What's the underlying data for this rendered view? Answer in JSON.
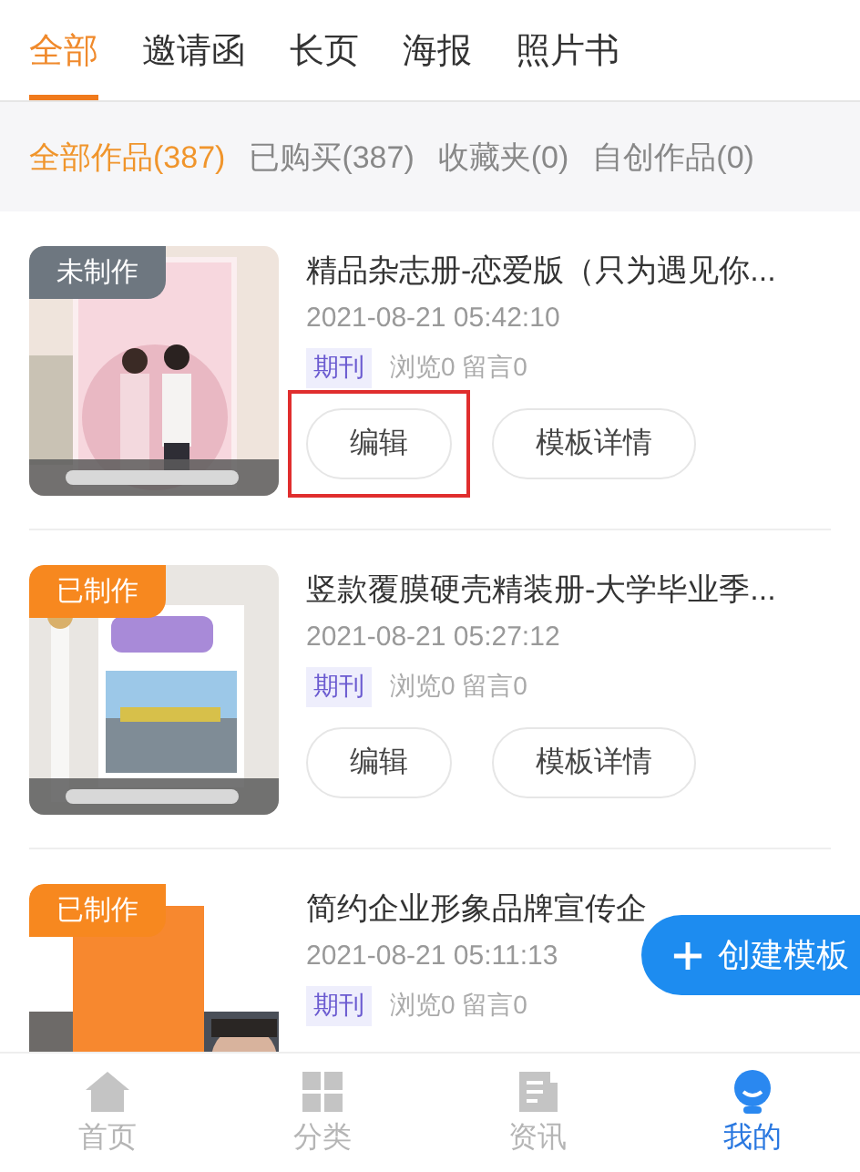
{
  "tabs": [
    {
      "label": "全部",
      "selected": true
    },
    {
      "label": "邀请函",
      "selected": false
    },
    {
      "label": "长页",
      "selected": false
    },
    {
      "label": "海报",
      "selected": false
    },
    {
      "label": "照片书",
      "selected": false
    }
  ],
  "filters": [
    {
      "label": "全部作品(387)",
      "selected": true
    },
    {
      "label": "已购买(387)",
      "selected": false
    },
    {
      "label": "收藏夹(0)",
      "selected": false
    },
    {
      "label": "自创作品(0)",
      "selected": false
    }
  ],
  "works": [
    {
      "status": {
        "label": "未制作",
        "done": false
      },
      "title": "精品杂志册-恋爱版（只为遇见你...",
      "date": "2021-08-21 05:42:10",
      "tag": "期刊",
      "stats": "浏览0 留言0",
      "buttons": [
        {
          "label": "编辑",
          "highlighted": true
        },
        {
          "label": "模板详情",
          "highlighted": false
        }
      ]
    },
    {
      "status": {
        "label": "已制作",
        "done": true
      },
      "title": "竖款覆膜硬壳精装册-大学毕业季...",
      "date": "2021-08-21 05:27:12",
      "tag": "期刊",
      "stats": "浏览0 留言0",
      "buttons": [
        {
          "label": "编辑",
          "highlighted": false
        },
        {
          "label": "模板详情",
          "highlighted": false
        }
      ]
    },
    {
      "status": {
        "label": "已制作",
        "done": true
      },
      "title": "简约企业形象品牌宣传企",
      "date": "2021-08-21 05:11:13",
      "tag": "期刊",
      "stats": "浏览0 留言0"
    }
  ],
  "create_button": {
    "label": "创建模板"
  },
  "nav": [
    {
      "kind": "home",
      "label": "首页",
      "selected": false
    },
    {
      "kind": "grid",
      "label": "分类",
      "selected": false
    },
    {
      "kind": "news",
      "label": "资讯",
      "selected": false
    },
    {
      "kind": "user",
      "label": "我的",
      "selected": true
    }
  ]
}
